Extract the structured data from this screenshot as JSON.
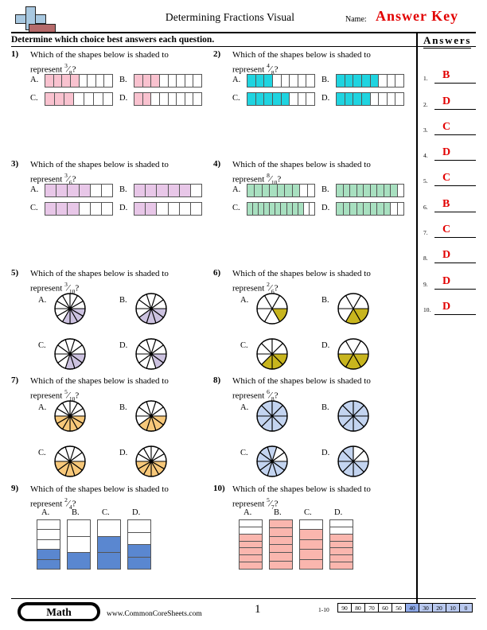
{
  "header": {
    "title": "Determining Fractions Visual",
    "name_label": "Name:",
    "answer_key": "Answer Key",
    "instructions": "Determine which choice best answers each question.",
    "logo_icon": "math-cross-book-logo"
  },
  "answers_panel": {
    "heading": "Answers",
    "rows": [
      {
        "num": "1.",
        "value": "B"
      },
      {
        "num": "2.",
        "value": "D"
      },
      {
        "num": "3.",
        "value": "C"
      },
      {
        "num": "4.",
        "value": "D"
      },
      {
        "num": "5.",
        "value": "C"
      },
      {
        "num": "6.",
        "value": "B"
      },
      {
        "num": "7.",
        "value": "C"
      },
      {
        "num": "8.",
        "value": "D"
      },
      {
        "num": "9.",
        "value": "D"
      },
      {
        "num": "10.",
        "value": "D"
      }
    ],
    "answer_color": "#e20000"
  },
  "prompt_text_a": "Which of the shapes below is shaded to",
  "prompt_text_b": "represent",
  "choice_labels": [
    "A.",
    "B.",
    "C.",
    "D."
  ],
  "questions": [
    {
      "num": "1)",
      "numerator": "3",
      "denominator": "8",
      "shape": "hbar",
      "color": "#f9c2cf",
      "choices": [
        {
          "label": "A.",
          "total": 8,
          "shaded": 4
        },
        {
          "label": "B.",
          "total": 8,
          "shaded": 3
        },
        {
          "label": "C.",
          "total": 7,
          "shaded": 3
        },
        {
          "label": "D.",
          "total": 8,
          "shaded": 2
        }
      ]
    },
    {
      "num": "2)",
      "numerator": "4",
      "denominator": "8",
      "shape": "hbar",
      "color": "#1fd4e0",
      "choices": [
        {
          "label": "A.",
          "total": 8,
          "shaded": 3
        },
        {
          "label": "B.",
          "total": 8,
          "shaded": 5
        },
        {
          "label": "C.",
          "total": 8,
          "shaded": 5
        },
        {
          "label": "D.",
          "total": 8,
          "shaded": 4
        }
      ]
    },
    {
      "num": "3)",
      "numerator": "3",
      "denominator": "6",
      "shape": "hbar",
      "color": "#e8c7e8",
      "choices": [
        {
          "label": "A.",
          "total": 6,
          "shaded": 4
        },
        {
          "label": "B.",
          "total": 6,
          "shaded": 5
        },
        {
          "label": "C.",
          "total": 6,
          "shaded": 3
        },
        {
          "label": "D.",
          "total": 6,
          "shaded": 2
        }
      ]
    },
    {
      "num": "4)",
      "numerator": "8",
      "denominator": "10",
      "shape": "hbar",
      "color": "#a8e0c0",
      "choices": [
        {
          "label": "A.",
          "total": 9,
          "shaded": 7
        },
        {
          "label": "B.",
          "total": 10,
          "shaded": 9
        },
        {
          "label": "C.",
          "total": 12,
          "shaded": 10
        },
        {
          "label": "D.",
          "total": 10,
          "shaded": 8
        }
      ]
    },
    {
      "num": "5)",
      "numerator": "3",
      "denominator": "10",
      "shape": "pie",
      "color": "#ccc2e0",
      "choices": [
        {
          "label": "A.",
          "total": 12,
          "shaded": 4
        },
        {
          "label": "B.",
          "total": 10,
          "shaded": 4
        },
        {
          "label": "C.",
          "total": 10,
          "shaded": 3
        },
        {
          "label": "D.",
          "total": 10,
          "shaded": 2
        }
      ]
    },
    {
      "num": "6)",
      "numerator": "2",
      "denominator": "6",
      "shape": "pie",
      "color": "#c8b51e",
      "choices": [
        {
          "label": "A.",
          "total": 6,
          "shaded": 1
        },
        {
          "label": "B.",
          "total": 6,
          "shaded": 2
        },
        {
          "label": "C.",
          "total": 8,
          "shaded": 3
        },
        {
          "label": "D.",
          "total": 6,
          "shaded": 3
        }
      ]
    },
    {
      "num": "7)",
      "numerator": "5",
      "denominator": "10",
      "shape": "pie",
      "color": "#f7c87a",
      "choices": [
        {
          "label": "A.",
          "total": 12,
          "shaded": 6
        },
        {
          "label": "B.",
          "total": 10,
          "shaded": 4
        },
        {
          "label": "C.",
          "total": 10,
          "shaded": 5
        },
        {
          "label": "D.",
          "total": 12,
          "shaded": 6
        }
      ]
    },
    {
      "num": "8)",
      "numerator": "6",
      "denominator": "8",
      "shape": "pie",
      "color": "#c3d4f0",
      "choices": [
        {
          "label": "A.",
          "total": 8,
          "shaded": 8
        },
        {
          "label": "B.",
          "total": 8,
          "shaded": 8
        },
        {
          "label": "C.",
          "total": 10,
          "shaded": 8
        },
        {
          "label": "D.",
          "total": 8,
          "shaded": 6
        }
      ]
    },
    {
      "num": "9)",
      "numerator": "2",
      "denominator": "4",
      "shape": "vbar",
      "color": "#5a87d0",
      "choices": [
        {
          "label": "A.",
          "total": 5,
          "shaded": 2
        },
        {
          "label": "B.",
          "total": 3,
          "shaded": 1
        },
        {
          "label": "C.",
          "total": 3,
          "shaded": 2
        },
        {
          "label": "D.",
          "total": 4,
          "shaded": 2
        }
      ]
    },
    {
      "num": "10)",
      "numerator": "5",
      "denominator": "7",
      "shape": "vbar",
      "color": "#fab6ae",
      "choices": [
        {
          "label": "A.",
          "total": 7,
          "shaded": 5
        },
        {
          "label": "B.",
          "total": 6,
          "shaded": 6
        },
        {
          "label": "C.",
          "total": 5,
          "shaded": 4
        },
        {
          "label": "D.",
          "total": 7,
          "shaded": 5
        }
      ]
    }
  ],
  "footer": {
    "subject": "Math",
    "site": "www.CommonCoreSheets.com",
    "page_number": "1",
    "score_label": "1-10",
    "score_values": [
      "90",
      "80",
      "70",
      "60",
      "50",
      "40",
      "30",
      "20",
      "10",
      "0"
    ],
    "score_selected": "40"
  }
}
